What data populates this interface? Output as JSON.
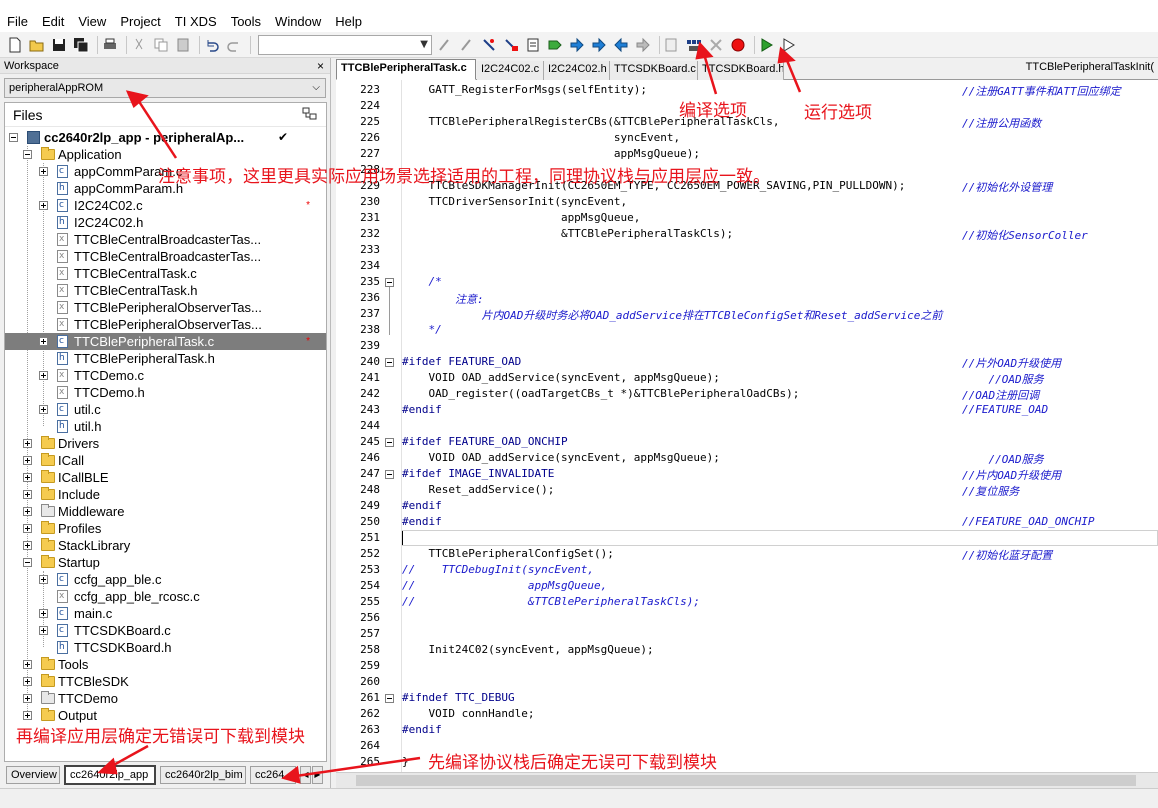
{
  "menu": [
    "File",
    "Edit",
    "View",
    "Project",
    "TI XDS",
    "Tools",
    "Window",
    "Help"
  ],
  "workspace": {
    "title": "Workspace",
    "config": "peripheralAppROM",
    "files_label": "Files",
    "project": "cc2640r2lp_app - peripheralAp...",
    "tree": [
      {
        "label": "Application",
        "kind": "folder",
        "level": 1,
        "exp": "minus"
      },
      {
        "label": "appCommParam.c",
        "kind": "c",
        "level": 2,
        "exp": "plus"
      },
      {
        "label": "appCommParam.h",
        "kind": "h",
        "level": 2,
        "exp": ""
      },
      {
        "label": "I2C24C02.c",
        "kind": "c",
        "level": 2,
        "exp": "plus",
        "dot": true
      },
      {
        "label": "I2C24C02.h",
        "kind": "h",
        "level": 2,
        "exp": ""
      },
      {
        "label": "TTCBleCentralBroadcasterTas...",
        "kind": "x",
        "level": 2,
        "exp": ""
      },
      {
        "label": "TTCBleCentralBroadcasterTas...",
        "kind": "x",
        "level": 2,
        "exp": ""
      },
      {
        "label": "TTCBleCentralTask.c",
        "kind": "x",
        "level": 2,
        "exp": ""
      },
      {
        "label": "TTCBleCentralTask.h",
        "kind": "x",
        "level": 2,
        "exp": ""
      },
      {
        "label": "TTCBlePeripheralObserverTas...",
        "kind": "x",
        "level": 2,
        "exp": ""
      },
      {
        "label": "TTCBlePeripheralObserverTas...",
        "kind": "x",
        "level": 2,
        "exp": ""
      },
      {
        "label": "TTCBlePeripheralTask.c",
        "kind": "c",
        "level": 2,
        "exp": "plus",
        "sel": true,
        "dot": true
      },
      {
        "label": "TTCBlePeripheralTask.h",
        "kind": "h",
        "level": 2,
        "exp": ""
      },
      {
        "label": "TTCDemo.c",
        "kind": "x",
        "level": 2,
        "exp": "plus"
      },
      {
        "label": "TTCDemo.h",
        "kind": "x",
        "level": 2,
        "exp": ""
      },
      {
        "label": "util.c",
        "kind": "c",
        "level": 2,
        "exp": "plus"
      },
      {
        "label": "util.h",
        "kind": "h",
        "level": 2,
        "exp": ""
      },
      {
        "label": "Drivers",
        "kind": "folder",
        "level": 1,
        "exp": "plus"
      },
      {
        "label": "ICall",
        "kind": "folder",
        "level": 1,
        "exp": "plus"
      },
      {
        "label": "ICallBLE",
        "kind": "folder",
        "level": 1,
        "exp": "plus"
      },
      {
        "label": "Include",
        "kind": "folder",
        "level": 1,
        "exp": "plus"
      },
      {
        "label": "Middleware",
        "kind": "greyfolder",
        "level": 1,
        "exp": "plus"
      },
      {
        "label": "Profiles",
        "kind": "folder",
        "level": 1,
        "exp": "plus"
      },
      {
        "label": "StackLibrary",
        "kind": "folder",
        "level": 1,
        "exp": "plus"
      },
      {
        "label": "Startup",
        "kind": "folder",
        "level": 1,
        "exp": "minus"
      },
      {
        "label": "ccfg_app_ble.c",
        "kind": "c",
        "level": 2,
        "exp": "plus"
      },
      {
        "label": "ccfg_app_ble_rcosc.c",
        "kind": "x",
        "level": 2,
        "exp": ""
      },
      {
        "label": "main.c",
        "kind": "c",
        "level": 2,
        "exp": "plus"
      },
      {
        "label": "TTCSDKBoard.c",
        "kind": "c",
        "level": 2,
        "exp": "plus"
      },
      {
        "label": "TTCSDKBoard.h",
        "kind": "h",
        "level": 2,
        "exp": ""
      },
      {
        "label": "Tools",
        "kind": "folder",
        "level": 1,
        "exp": "plus"
      },
      {
        "label": "TTCBleSDK",
        "kind": "folder",
        "level": 1,
        "exp": "plus"
      },
      {
        "label": "TTCDemo",
        "kind": "greyfolder",
        "level": 1,
        "exp": "plus"
      },
      {
        "label": "Output",
        "kind": "folder",
        "level": 1,
        "exp": "plus"
      }
    ],
    "bottom_tabs": [
      "Overview",
      "cc2640r2lp_app",
      "cc2640r2lp_bim",
      "cc264"
    ]
  },
  "editor": {
    "tabs": [
      "TTCBlePeripheralTask.c",
      "I2C24C02.c",
      "I2C24C02.h",
      "TTCSDKBoard.c",
      "TTCSDKBoard.h"
    ],
    "function": "TTCBlePeripheralTaskInit(",
    "lines": [
      {
        "n": "223",
        "code": "    GATT_RegisterForMsgs(selfEntity);",
        "cm": "//注册GATT事件和ATT回应绑定"
      },
      {
        "n": "224",
        "code": "",
        "cm": ""
      },
      {
        "n": "225",
        "code": "    TTCBlePeripheralRegisterCBs(&TTCBlePeripheralTaskCls,",
        "cm": "//注册公用函数"
      },
      {
        "n": "226",
        "code": "                                syncEvent,",
        "cm": ""
      },
      {
        "n": "227",
        "code": "                                appMsgQueue);",
        "cm": ""
      },
      {
        "n": "228",
        "code": "",
        "cm": ""
      },
      {
        "n": "229",
        "code": "    TTCBleSDKManagerInit(CC2650EM_TYPE, CC2650EM_POWER_SAVING,PIN_PULLDOWN);",
        "cm": "//初始化外设管理"
      },
      {
        "n": "230",
        "code": "    TTCDriverSensorInit(syncEvent,",
        "cm": ""
      },
      {
        "n": "231",
        "code": "                        appMsgQueue,",
        "cm": ""
      },
      {
        "n": "232",
        "code": "                        &TTCBlePeripheralTaskCls);",
        "cm": "//初始化SensorColler"
      },
      {
        "n": "233",
        "code": "",
        "cm": ""
      },
      {
        "n": "234",
        "code": "",
        "cm": ""
      },
      {
        "n": "235",
        "code": "",
        "cm": "    /*"
      },
      {
        "n": "236",
        "code": "",
        "cm": "        注意:"
      },
      {
        "n": "237",
        "code": "",
        "cm": "            片内OAD升级时务必将OAD_addService排在TTCBleConfigSet和Reset_addService之前"
      },
      {
        "n": "238",
        "code": "",
        "cm": "    */"
      },
      {
        "n": "239",
        "code": "",
        "cm": ""
      },
      {
        "n": "240",
        "code": "#ifdef FEATURE_OAD",
        "cm": "//片外OAD升级使用"
      },
      {
        "n": "241",
        "code": "    VOID OAD_addService(syncEvent, appMsgQueue);",
        "cm": "    //OAD服务"
      },
      {
        "n": "242",
        "code": "    OAD_register((oadTargetCBs_t *)&TTCBlePeripheralOadCBs);",
        "cm": "//OAD注册回调"
      },
      {
        "n": "243",
        "code": "#endif",
        "cm": "//FEATURE_OAD"
      },
      {
        "n": "244",
        "code": "",
        "cm": ""
      },
      {
        "n": "245",
        "code": "#ifdef FEATURE_OAD_ONCHIP",
        "cm": ""
      },
      {
        "n": "246",
        "code": "    VOID OAD_addService(syncEvent, appMsgQueue);",
        "cm": "    //OAD服务"
      },
      {
        "n": "247",
        "code": "#ifdef IMAGE_INVALIDATE",
        "cm": "//片内OAD升级使用"
      },
      {
        "n": "248",
        "code": "    Reset_addService();",
        "cm": "//复位服务"
      },
      {
        "n": "249",
        "code": "#endif",
        "cm": ""
      },
      {
        "n": "250",
        "code": "#endif",
        "cm": "//FEATURE_OAD_ONCHIP"
      },
      {
        "n": "251",
        "code": "",
        "cm": ""
      },
      {
        "n": "252",
        "code": "    TTCBlePeripheralConfigSet();",
        "cm": "//初始化蓝牙配置"
      },
      {
        "n": "253",
        "code": "",
        "cm": "//    TTCDebugInit(syncEvent,"
      },
      {
        "n": "254",
        "code": "",
        "cm": "//                 appMsgQueue,"
      },
      {
        "n": "255",
        "code": "",
        "cm": "//                 &TTCBlePeripheralTaskCls);"
      },
      {
        "n": "256",
        "code": "",
        "cm": ""
      },
      {
        "n": "257",
        "code": "",
        "cm": ""
      },
      {
        "n": "258",
        "code": "    Init24C02(syncEvent, appMsgQueue);",
        "cm": ""
      },
      {
        "n": "259",
        "code": "",
        "cm": ""
      },
      {
        "n": "260",
        "code": "",
        "cm": ""
      },
      {
        "n": "261",
        "code": "#ifndef TTC_DEBUG",
        "cm": ""
      },
      {
        "n": "262",
        "code": "    VOID connHandle;",
        "cm": ""
      },
      {
        "n": "263",
        "code": "#endif",
        "cm": ""
      },
      {
        "n": "264",
        "code": "",
        "cm": ""
      },
      {
        "n": "265",
        "code": "}",
        "cm": ""
      }
    ]
  },
  "annotations": {
    "compile": "编译选项",
    "run": "运行选项",
    "note": "注意事项，这里更具实际应用场景选择适用的工程，同理协议栈与应用层应一致。",
    "app_first": "再编译应用层确定无错误可下载到模块",
    "stack_first": "先编译协议栈后确定无误可下载到模块"
  },
  "colors": {
    "annotation": "#e8141c",
    "comment": "#1a1acc",
    "keyword": "#00008b",
    "selection": "#7d7d7d"
  }
}
